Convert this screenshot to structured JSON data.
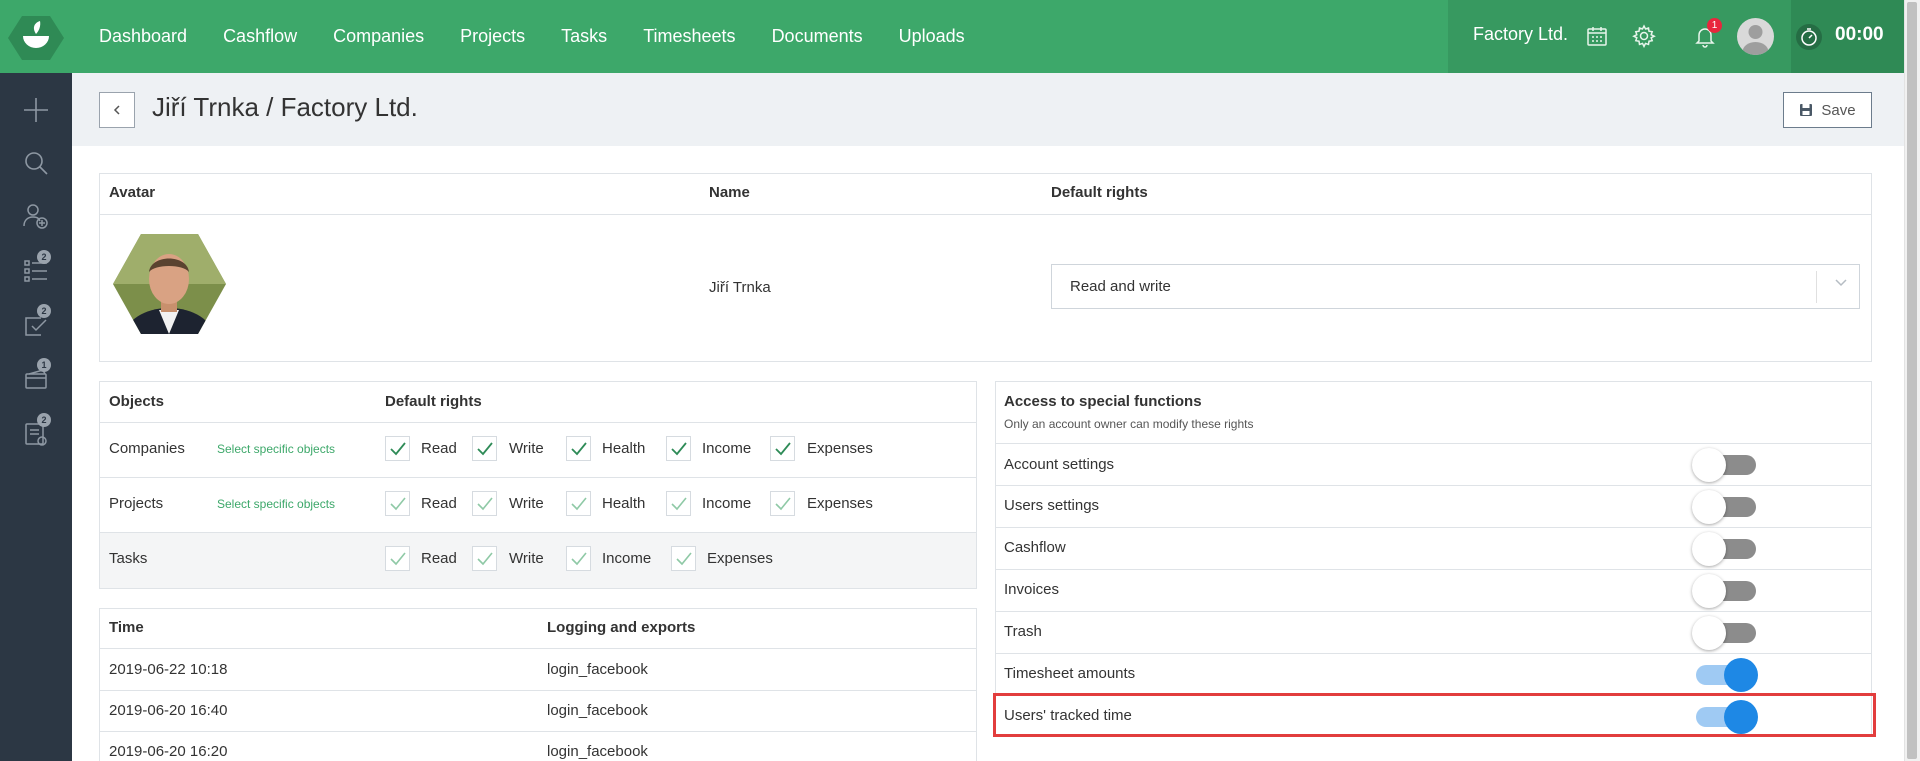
{
  "nav": {
    "items": [
      "Dashboard",
      "Cashflow",
      "Companies",
      "Projects",
      "Tasks",
      "Timesheets",
      "Documents",
      "Uploads"
    ]
  },
  "topbar": {
    "company": "Factory Ltd.",
    "notification_count": "1",
    "timer": "00:00"
  },
  "sidebar": {
    "badges": {
      "tasks": "2",
      "approvals": "2",
      "invoices": "1",
      "reports": "2"
    }
  },
  "page": {
    "title": "Jiří Trnka / Factory Ltd.",
    "save_label": "Save"
  },
  "profile": {
    "headers": {
      "avatar": "Avatar",
      "name": "Name",
      "default_rights": "Default rights"
    },
    "name": "Jiří Trnka",
    "default_rights_value": "Read and write"
  },
  "objects": {
    "headers": {
      "objects": "Objects",
      "default_rights": "Default rights"
    },
    "select_link": "Select specific objects",
    "rows": [
      {
        "label": "Companies",
        "rights": [
          "Read",
          "Write",
          "Health",
          "Income",
          "Expenses"
        ],
        "checked": [
          true,
          true,
          true,
          true,
          true
        ]
      },
      {
        "label": "Projects",
        "rights": [
          "Read",
          "Write",
          "Health",
          "Income",
          "Expenses"
        ],
        "checked": [
          true,
          true,
          true,
          true,
          true
        ]
      },
      {
        "label": "Tasks",
        "rights": [
          "Read",
          "Write",
          "Income",
          "Expenses"
        ],
        "checked": [
          true,
          true,
          true,
          true
        ]
      }
    ]
  },
  "log": {
    "headers": {
      "time": "Time",
      "logging": "Logging and exports"
    },
    "rows": [
      {
        "time": "2019-06-22 10:18",
        "event": "login_facebook"
      },
      {
        "time": "2019-06-20 16:40",
        "event": "login_facebook"
      },
      {
        "time": "2019-06-20 16:20",
        "event": "login_facebook"
      }
    ]
  },
  "special": {
    "title": "Access to special functions",
    "subtitle": "Only an account owner can modify these rights",
    "items": [
      {
        "label": "Account settings",
        "enabled": false
      },
      {
        "label": "Users settings",
        "enabled": false
      },
      {
        "label": "Cashflow",
        "enabled": false
      },
      {
        "label": "Invoices",
        "enabled": false
      },
      {
        "label": "Trash",
        "enabled": false
      },
      {
        "label": "Timesheet amounts",
        "enabled": true
      },
      {
        "label": "Users' tracked time",
        "enabled": true
      }
    ]
  },
  "colors": {
    "brand": "#3da86a",
    "sidebar": "#2c3744",
    "toggle_on": "#1e88e5",
    "highlight": "#e23d3d"
  }
}
